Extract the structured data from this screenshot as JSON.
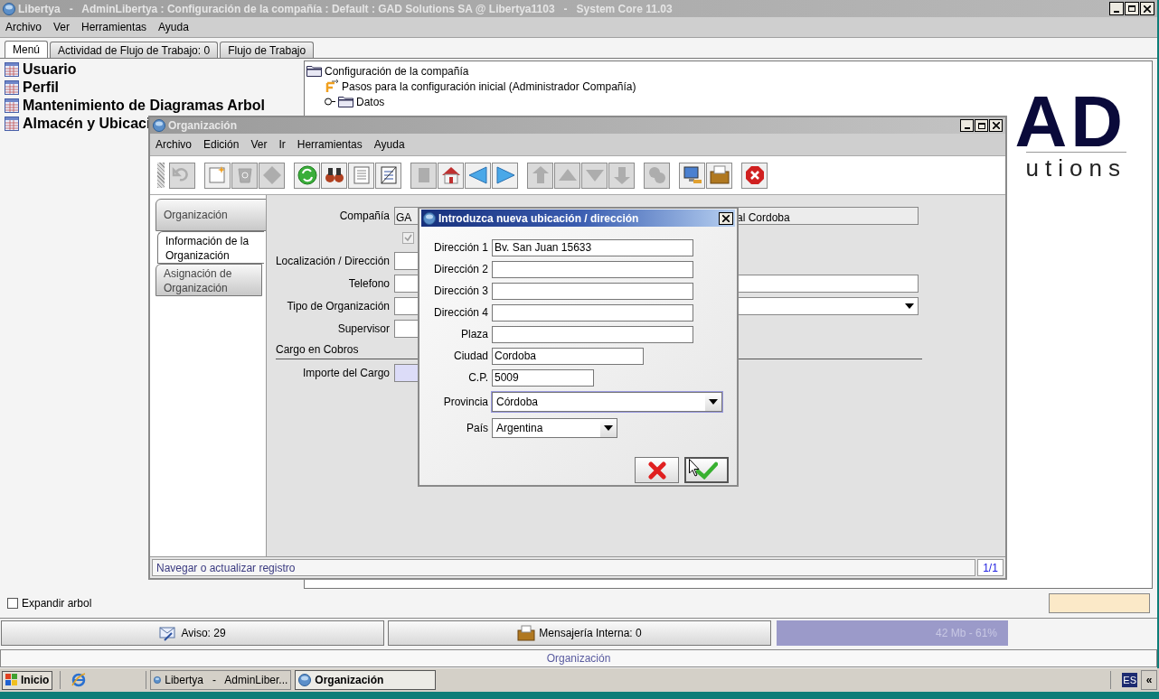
{
  "window": {
    "title": "Libertya   -   AdminLibertya : Configuración de la compañía : Default : GAD Solutions SA @ Libertya1103   -   System Core 11.03"
  },
  "menu": [
    "Archivo",
    "Ver",
    "Herramientas",
    "Ayuda"
  ],
  "tabs": [
    {
      "label": "Menú",
      "selected": true
    },
    {
      "label": "Actividad de Flujo de Trabajo: 0",
      "selected": false
    },
    {
      "label": "Flujo de Trabajo",
      "selected": false
    }
  ],
  "menu_items": [
    "Usuario",
    "Perfil",
    "Mantenimiento de Diagramas Arbol",
    "Almacén y Ubicaci"
  ],
  "tree": [
    {
      "label": "Configuración de la compañía",
      "kind": "folder",
      "children": [
        {
          "label": "Pasos para la configuración inicial (Administrador Compañía)",
          "kind": "workflow"
        },
        {
          "label": "Datos",
          "kind": "folder",
          "expanded": false
        }
      ]
    }
  ],
  "logo": {
    "mark": "AD",
    "tagline": "utions"
  },
  "expand_tree": {
    "label": "Expandir arbol",
    "checked": false
  },
  "bottom_bar": {
    "notices": "Aviso: 29",
    "messages": "Mensajería Interna: 0",
    "memory": "42 Mb - 61%"
  },
  "status": "Organización",
  "org_window": {
    "title": "Organización",
    "menu": [
      "Archivo",
      "Edición",
      "Ver",
      "Ir",
      "Herramientas",
      "Ayuda"
    ],
    "toolbar": [
      {
        "disabled": true
      },
      {
        "disabled": false
      },
      {
        "disabled": true
      },
      {
        "disabled": true
      },
      {
        "disabled": false
      },
      {
        "disabled": false
      },
      {
        "disabled": false
      },
      {
        "disabled": false
      },
      {
        "disabled": true
      },
      {
        "disabled": false
      },
      {
        "disabled": false
      },
      {
        "disabled": false
      },
      {
        "disabled": true
      },
      {
        "disabled": true
      },
      {
        "disabled": true
      },
      {
        "disabled": true
      },
      {
        "disabled": true
      },
      {
        "disabled": false
      },
      {
        "disabled": false
      },
      {
        "disabled": false
      }
    ],
    "side_tabs": [
      {
        "label": "Organización",
        "selected": false
      },
      {
        "label": "Información de la Organización",
        "selected": true
      },
      {
        "label": "Asignación de Organización",
        "selected": false
      }
    ],
    "company": {
      "label": "Compañía",
      "value_start": "GA",
      "value_end": "al Cordoba"
    },
    "active_checked": true,
    "fields": [
      {
        "label": "Localización / Dirección",
        "kind": "text"
      },
      {
        "label": "Telefono",
        "kind": "text"
      },
      {
        "label": "Tipo de Organización",
        "kind": "select"
      },
      {
        "label": "Supervisor",
        "kind": "text"
      }
    ],
    "section": "Cargo en Cobros",
    "charge": {
      "label": "Importe del Cargo"
    },
    "status": "Navegar o actualizar registro",
    "record": "1/1"
  },
  "dialog": {
    "title": "Introduzca nueva ubicación / dirección",
    "fields": [
      {
        "label": "Dirección 1",
        "value": "Bv. San Juan 15633",
        "kind": "text"
      },
      {
        "label": "Dirección 2",
        "kind": "text"
      },
      {
        "label": "Dirección 3",
        "kind": "text"
      },
      {
        "label": "Dirección 4",
        "kind": "text"
      },
      {
        "label": "Plaza",
        "kind": "text"
      },
      {
        "label": "Ciudad",
        "value": "Cordoba",
        "kind": "text"
      },
      {
        "label": "C.P.",
        "value": "5009",
        "kind": "text"
      },
      {
        "label": "Provincia",
        "value": "Córdoba",
        "kind": "select"
      },
      {
        "label": "País",
        "value": "Argentina",
        "kind": "select"
      }
    ]
  },
  "taskbar": {
    "start": "Inicio",
    "tasks": [
      {
        "label": "Libertya   -   AdminLiber...",
        "selected": false
      },
      {
        "label": "Organización",
        "selected": true
      }
    ],
    "language": "ES",
    "tray_toggle": "«"
  }
}
